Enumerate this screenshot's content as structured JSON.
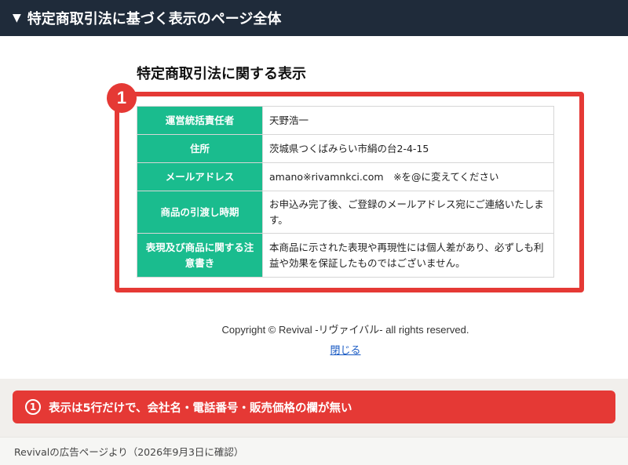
{
  "header": {
    "title": "特定商取引法に基づく表示のページ全体"
  },
  "page": {
    "heading": "特定商取引法に関する表示"
  },
  "badge": {
    "number": "1"
  },
  "table": {
    "rows": [
      {
        "label": "運営統括責任者",
        "value": "天野浩一"
      },
      {
        "label": "住所",
        "value": "茨城県つくばみらい市絹の台2-4-15"
      },
      {
        "label": "メールアドレス",
        "value": "amano※rivamnkci.com　※を@に変えてください"
      },
      {
        "label": "商品の引渡し時期",
        "value": "お申込み完了後、ご登録のメールアドレス宛にご連絡いたします。"
      },
      {
        "label": "表現及び商品に関する注意書き",
        "value": "本商品に示された表現や再現性には個人差があり、必ずしも利益や効果を保証したものではございません。"
      }
    ]
  },
  "footer": {
    "copyright": "Copyright © Revival -リヴァイバル- all rights reserved.",
    "close_link": "閉じる"
  },
  "note": {
    "number": "1",
    "text": "表示は5行だけで、会社名・電話番号・販売価格の欄が無い"
  },
  "caption": {
    "text": "Revivalの広告ページより（2026年9月3日に確認）"
  },
  "colors": {
    "header_bg": "#1f2b3a",
    "accent_red": "#e53935",
    "table_header_green": "#1abc8e",
    "link_blue": "#1a5bc4"
  },
  "icons": {
    "header_toggle": "triangle-down-icon"
  }
}
